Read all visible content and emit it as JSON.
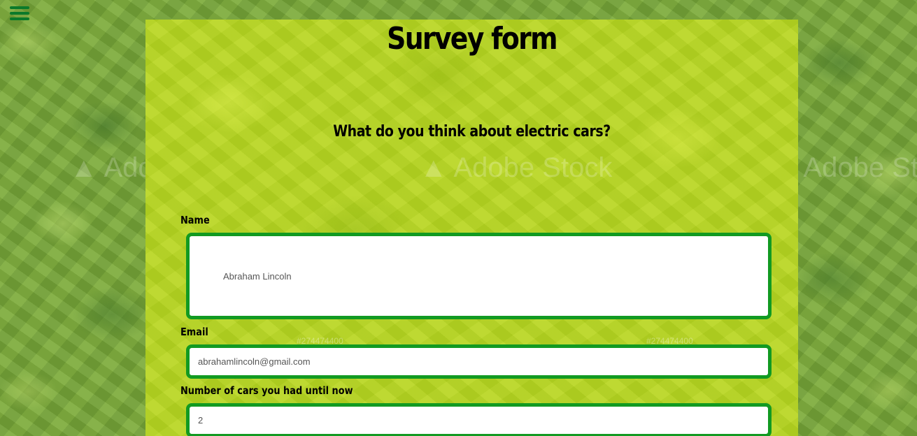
{
  "header": {
    "menu_icon": "hamburger-menu-icon"
  },
  "form": {
    "title": "Survey form",
    "description": "What do you think about electric cars?",
    "fields": {
      "name": {
        "label": "Name",
        "value": "Abraham Lincoln"
      },
      "email": {
        "label": "Email",
        "value": "abrahamlincoln@gmail.com"
      },
      "cars": {
        "label": "Number of cars you had until now",
        "value": "2"
      }
    }
  },
  "background": {
    "watermark_text": "Adobe Stock",
    "watermark_id": "#274474400"
  },
  "colors": {
    "accent": "#129a22",
    "panel": "#b6d424",
    "menu_icon": "#0b7a2a"
  }
}
